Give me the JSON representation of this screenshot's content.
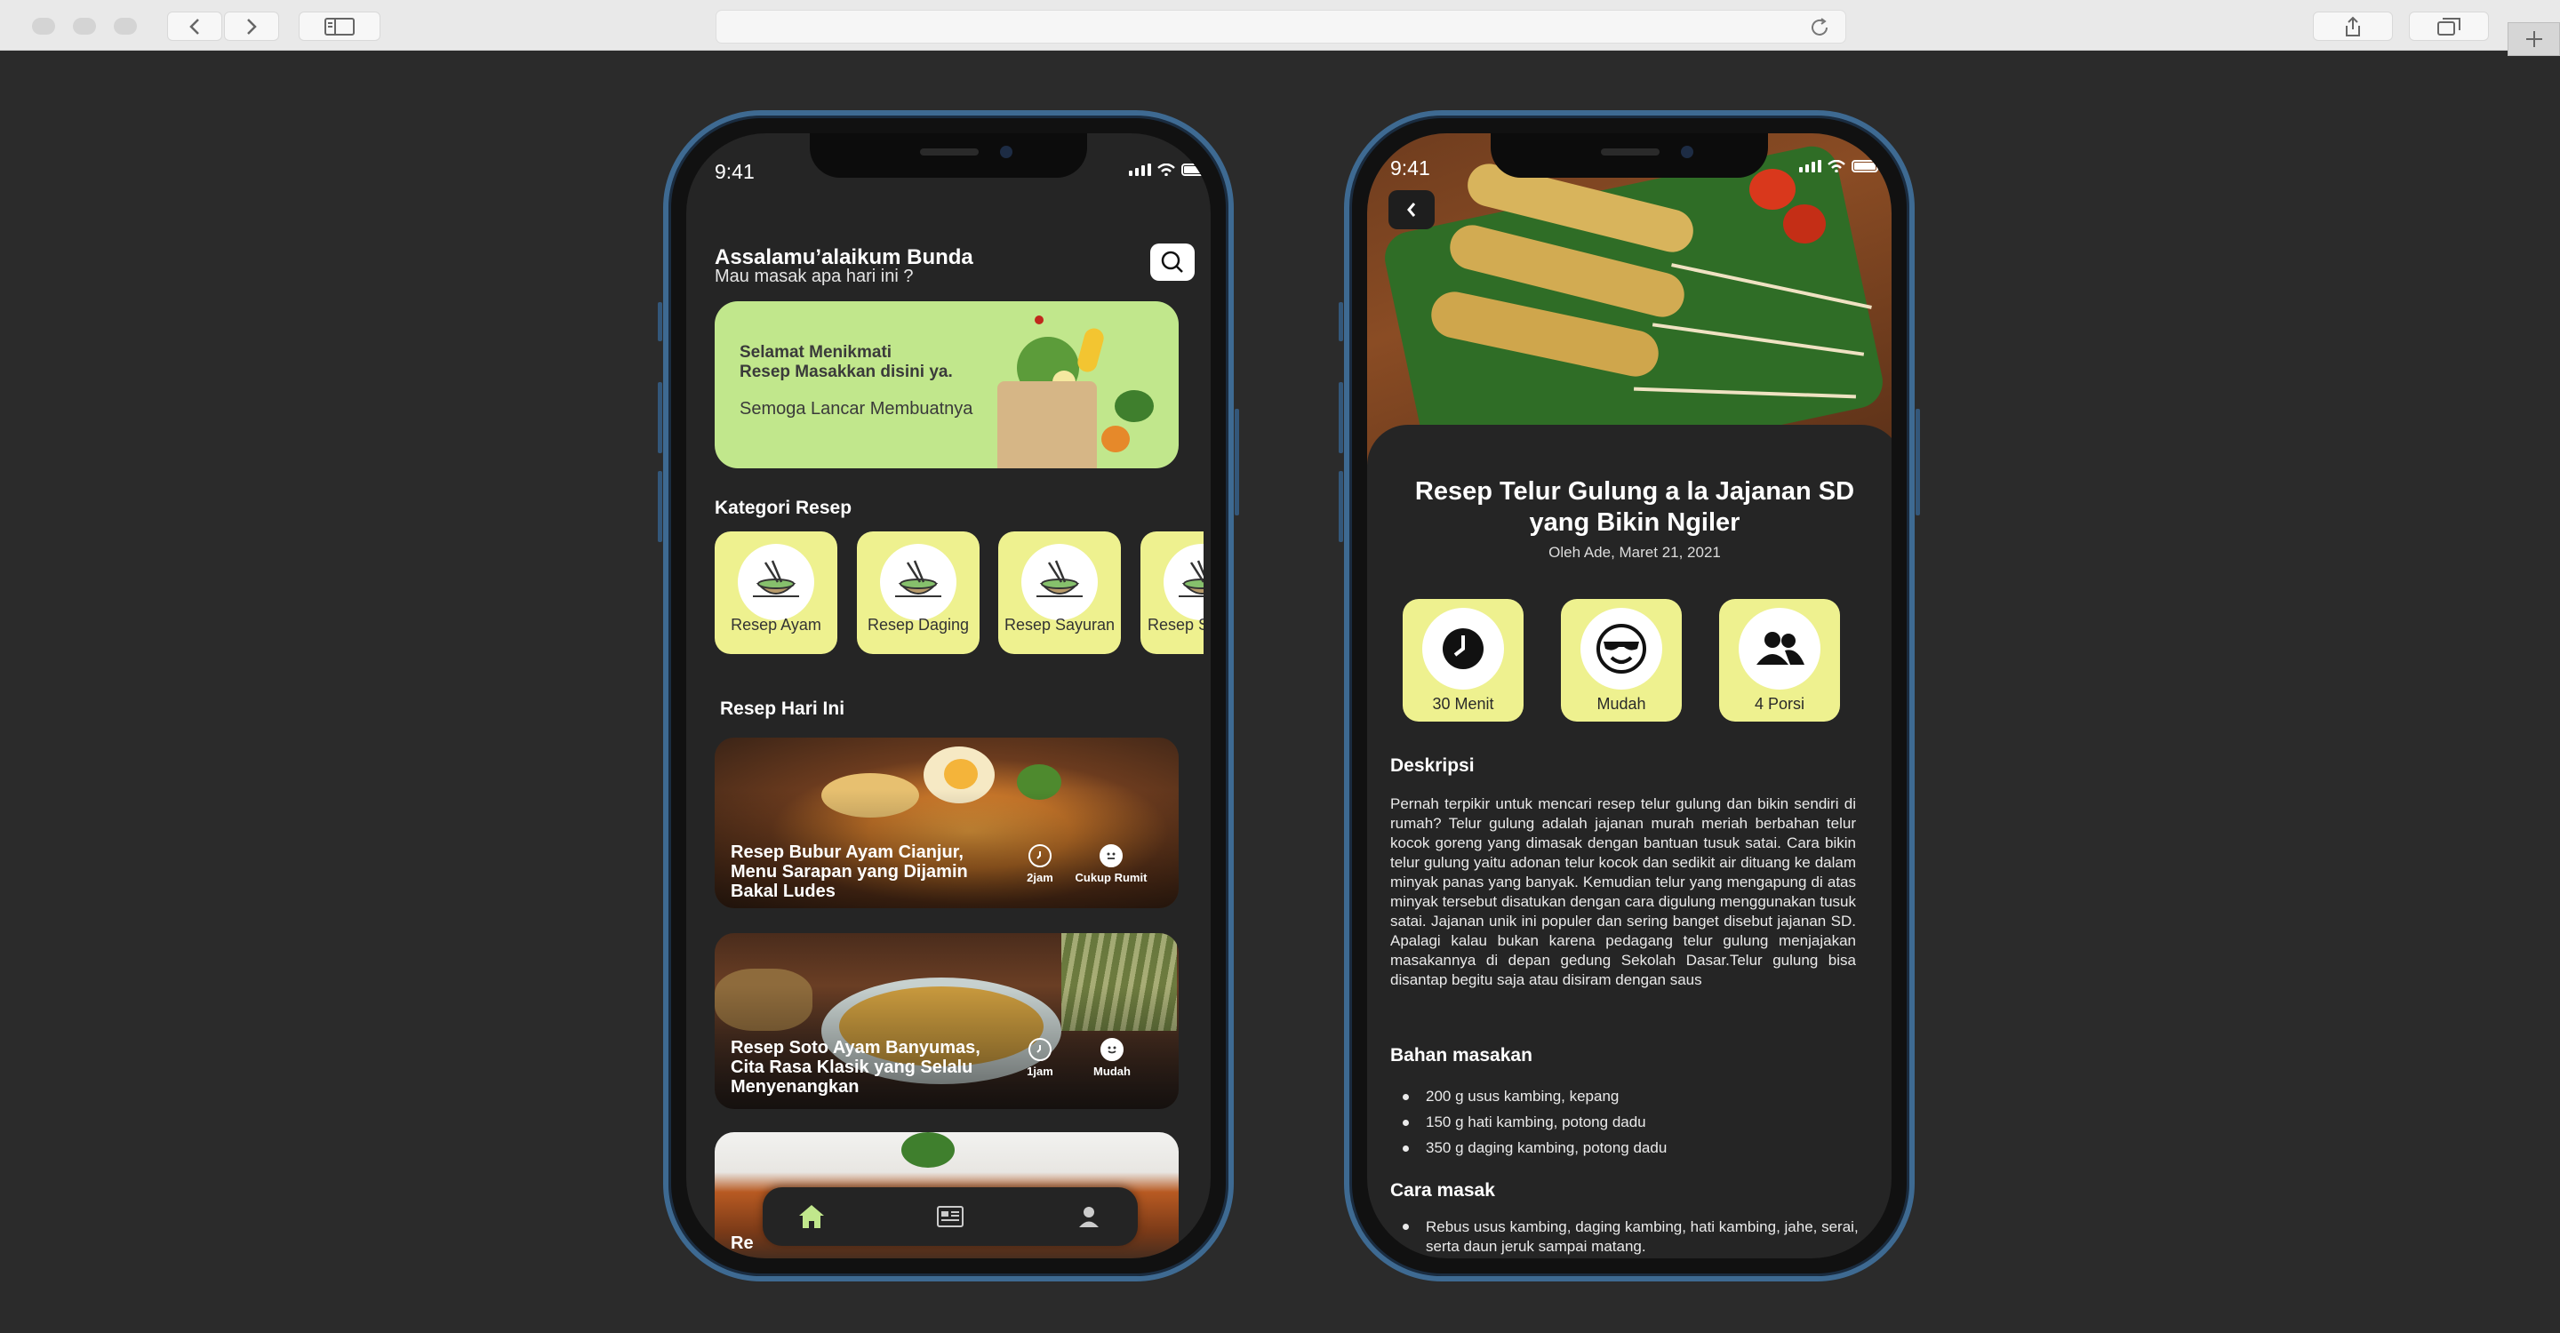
{
  "left_phone": {
    "status_time": "9:41",
    "greeting": "Assalamu’alaikum Bunda",
    "subtitle": "Mau masak apa hari ini ?",
    "banner": {
      "line1": "Selamat Menikmati",
      "line2": "Resep Masakkan disini ya.",
      "line3": "Semoga Lancar Membuatnya"
    },
    "categories_title": "Kategori Resep",
    "categories": [
      {
        "label": "Resep Ayam"
      },
      {
        "label": "Resep Daging"
      },
      {
        "label": "Resep Sayuran"
      },
      {
        "label": "Resep S"
      }
    ],
    "today_title": "Resep Hari Ini",
    "recipes": [
      {
        "title": "Resep Bubur Ayam Cianjur, Menu Sarapan yang Dijamin Bakal Ludes",
        "time": "2jam",
        "difficulty": "Cukup Rumit"
      },
      {
        "title": "Resep Soto Ayam Banyumas, Cita Rasa Klasik yang Selalu Menyenangkan",
        "time": "1jam",
        "difficulty": "Mudah"
      },
      {
        "title": "Re"
      }
    ],
    "tabs": [
      "home-icon",
      "news-icon",
      "profile-icon"
    ],
    "accent": "#c1e78c"
  },
  "right_phone": {
    "status_time": "9:41",
    "title": "Resep Telur Gulung a la Jajanan SD yang Bikin Ngiler",
    "author": "Oleh Ade, Maret 21, 2021",
    "info": [
      {
        "label": "30 Menit",
        "icon": "clock-icon"
      },
      {
        "label": "Mudah",
        "icon": "cool-face-icon"
      },
      {
        "label": "4 Porsi",
        "icon": "people-icon"
      }
    ],
    "description_title": "Deskripsi",
    "description": "Pernah terpikir untuk mencari resep telur gulung dan bikin sendiri di rumah? Telur gulung adalah jajanan murah meriah berbahan telur kocok goreng yang dimasak dengan bantuan tusuk satai. Cara bikin telur gulung yaitu adonan telur kocok dan sedikit air dituang ke dalam minyak panas yang banyak. Kemudian telur yang mengapung di atas minyak tersebut disatukan dengan cara digulung menggunakan tusuk satai. Jajanan unik ini populer dan sering banget disebut jajanan SD. Apalagi kalau bukan karena pedagang telur gulung menjajakan masakannya di depan gedung Sekolah Dasar.Telur gulung bisa disantap begitu saja atau disiram dengan saus",
    "ingredients_title": "Bahan masakan",
    "ingredients": [
      "200 g usus kambing, kepang",
      "150 g hati kambing, potong dadu",
      "350 g daging kambing, potong dadu"
    ],
    "steps_title": "Cara masak",
    "steps": [
      "Rebus usus kambing, daging kambing, hati kambing, jahe, serai, serta daun jeruk sampai matang."
    ],
    "card_color": "#eef18f"
  }
}
